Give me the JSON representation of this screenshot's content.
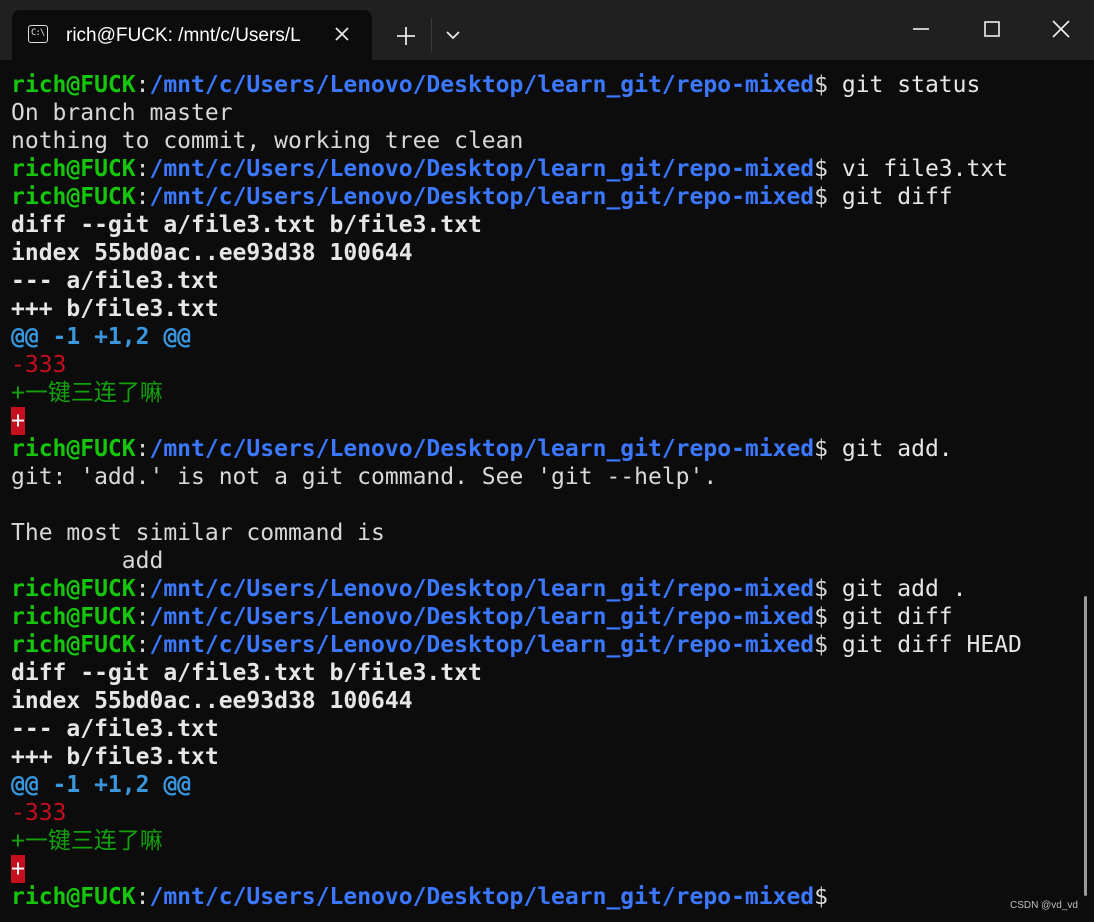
{
  "window": {
    "tab_title": "rich@FUCK: /mnt/c/Users/L",
    "tab_icon_text": "C:\\",
    "icons": [
      "terminal-icon",
      "close-icon",
      "plus-icon",
      "chevron-down-icon",
      "minimize-icon",
      "maximize-icon",
      "close-icon"
    ]
  },
  "colors": {
    "user": "#16c60c",
    "path": "#3b78ff",
    "text": "#d8d8d8",
    "hunk": "#3a96dd",
    "deletion": "#c50f1f",
    "addition": "#13a10e"
  },
  "terminal": {
    "user_host": "rich@FUCK",
    "colon": ":",
    "cwd": "/mnt/c/Users/Lenovo/Desktop/learn_git/repo-mixed",
    "prompt_symbol": "$",
    "lines": {
      "l1_cmd": " git status",
      "l2": "On branch master",
      "l3": "nothing to commit, working tree clean",
      "l4_cmd": " vi file3.txt",
      "l5_cmd": " git diff",
      "l6": "diff --git a/file3.txt b/file3.txt",
      "l7": "index 55bd0ac..ee93d38 100644",
      "l8": "--- a/file3.txt",
      "l9": "+++ b/file3.txt",
      "l10": "@@ -1 +1,2 @@",
      "l11": "-333",
      "l12": "+一键三连了嘛",
      "l13": "+",
      "l14_cmd": " git add.",
      "l15": "git: 'add.' is not a git command. See 'git --help'.",
      "l16": "",
      "l17": "The most similar command is",
      "l18": "        add",
      "l19_cmd": " git add .",
      "l20_cmd": " git diff",
      "l21_cmd": " git diff HEAD",
      "l22": "diff --git a/file3.txt b/file3.txt",
      "l23": "index 55bd0ac..ee93d38 100644",
      "l24": "--- a/file3.txt",
      "l25": "+++ b/file3.txt",
      "l26": "@@ -1 +1,2 @@",
      "l27": "-333",
      "l28": "+一键三连了嘛",
      "l29": "+",
      "l30_cmd": ""
    }
  },
  "watermark": "CSDN @vd_vd"
}
